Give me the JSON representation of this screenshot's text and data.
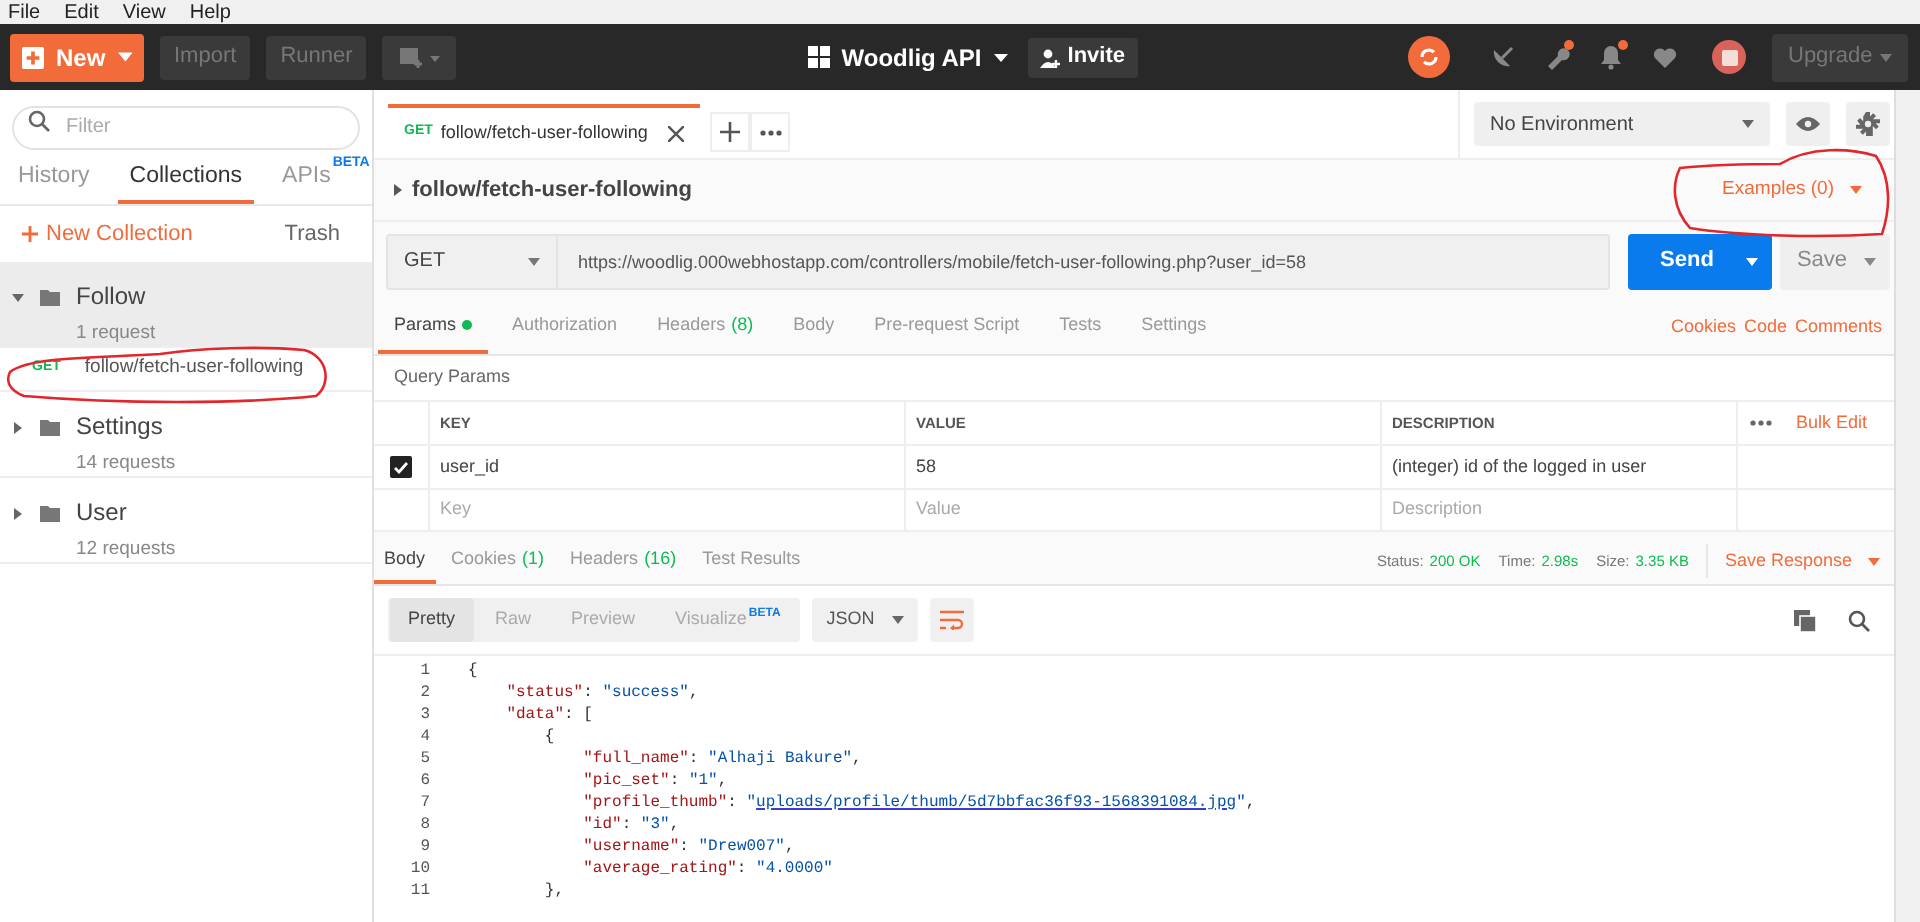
{
  "menu_bar": [
    "File",
    "Edit",
    "View",
    "Help"
  ],
  "header": {
    "new_button": "New",
    "buttons": [
      "Import",
      "Runner"
    ],
    "workspace": "Woodlig API",
    "invite": "Invite",
    "icons": [
      {
        "kind": "satellite",
        "dot": false
      },
      {
        "kind": "wrench",
        "dot": true
      },
      {
        "kind": "bell",
        "dot": true
      },
      {
        "kind": "heart",
        "dot": false
      }
    ],
    "upgrade": "Upgrade"
  },
  "sidebar": {
    "search": {
      "placeholder": "Filter"
    },
    "tabs": [
      {
        "label": "History",
        "selected": false
      },
      {
        "label": "Collections",
        "selected": true
      },
      {
        "label": "APIs",
        "badge": "BETA",
        "selected": false
      }
    ],
    "new_collection": "New Collection",
    "trash": "Trash",
    "collections": [
      {
        "name": "Follow",
        "count": "1 request",
        "expanded": true,
        "children": [
          {
            "method": "GET",
            "name": "follow/fetch-user-following",
            "selected": true
          }
        ]
      },
      {
        "name": "Settings",
        "count": "14 requests",
        "expanded": false
      },
      {
        "name": "User",
        "count": "12 requests",
        "expanded": false
      }
    ]
  },
  "request_tabs": [
    {
      "method": "GET",
      "label": "follow/fetch-user-following",
      "selected": true
    }
  ],
  "environment": "No Environment",
  "request": {
    "title": "follow/fetch-user-following",
    "examples": "Examples (0)",
    "method": "GET",
    "url": "https://woodlig.000webhostapp.com/controllers/mobile/fetch-user-following.php?user_id=58",
    "send": "Send",
    "save": "Save"
  },
  "request_sections": [
    {
      "label": "Params",
      "dot": true,
      "selected": true
    },
    {
      "label": "Authorization",
      "selected": false
    },
    {
      "label": "Headers",
      "count": "(8)",
      "selected": false
    },
    {
      "label": "Body",
      "selected": false
    },
    {
      "label": "Pre-request Script",
      "selected": false
    },
    {
      "label": "Tests",
      "selected": false
    },
    {
      "label": "Settings",
      "selected": false
    }
  ],
  "request_links": [
    "Cookies",
    "Code",
    "Comments"
  ],
  "query_params": {
    "title": "Query Params",
    "columns": [
      "KEY",
      "VALUE",
      "DESCRIPTION"
    ],
    "bulk_edit": "Bulk Edit",
    "rows": [
      {
        "checked": true,
        "key": "user_id",
        "value": "58",
        "description": "(integer) id of the logged in user"
      }
    ],
    "new_row": {
      "key": {
        "placeholder": "Key"
      },
      "value": {
        "placeholder": "Value"
      },
      "description": {
        "placeholder": "Description"
      }
    }
  },
  "response": {
    "tabs": [
      {
        "label": "Body",
        "selected": true
      },
      {
        "label": "Cookies",
        "count": "(1)",
        "selected": false
      },
      {
        "label": "Headers",
        "count": "(16)",
        "selected": false
      },
      {
        "label": "Test Results",
        "selected": false
      }
    ],
    "stats": [
      {
        "label": "Status:",
        "value": "200 OK"
      },
      {
        "label": "Time:",
        "value": "2.98s"
      },
      {
        "label": "Size:",
        "value": "3.35 KB"
      }
    ],
    "save_response": "Save Response",
    "views": [
      {
        "label": "Pretty",
        "selected": true
      },
      {
        "label": "Raw",
        "selected": false
      },
      {
        "label": "Preview",
        "selected": false
      },
      {
        "label": "Visualize",
        "badge": "BETA",
        "selected": false
      }
    ],
    "format": "JSON",
    "lines": [
      {
        "number": "1",
        "tokens": [
          {
            "kind": "punct",
            "text": "{"
          }
        ]
      },
      {
        "number": "2",
        "tokens": [
          {
            "kind": "key",
            "text": "    \"status\""
          },
          {
            "kind": "punct",
            "text": ": "
          },
          {
            "kind": "string",
            "text": "\"success\""
          },
          {
            "kind": "punct",
            "text": ","
          }
        ]
      },
      {
        "number": "3",
        "tokens": [
          {
            "kind": "key",
            "text": "    \"data\""
          },
          {
            "kind": "punct",
            "text": ": ["
          }
        ]
      },
      {
        "number": "4",
        "tokens": [
          {
            "kind": "punct",
            "text": "        {"
          }
        ]
      },
      {
        "number": "5",
        "tokens": [
          {
            "kind": "key",
            "text": "            \"full_name\""
          },
          {
            "kind": "punct",
            "text": ": "
          },
          {
            "kind": "string",
            "text": "\"Alhaji Bakure\""
          },
          {
            "kind": "punct",
            "text": ","
          }
        ]
      },
      {
        "number": "6",
        "tokens": [
          {
            "kind": "key",
            "text": "            \"pic_set\""
          },
          {
            "kind": "punct",
            "text": ": "
          },
          {
            "kind": "string",
            "text": "\"1\""
          },
          {
            "kind": "punct",
            "text": ","
          }
        ]
      },
      {
        "number": "7",
        "tokens": [
          {
            "kind": "key",
            "text": "            \"profile_thumb\""
          },
          {
            "kind": "punct",
            "text": ": "
          },
          {
            "kind": "string",
            "text": "\""
          },
          {
            "kind": "link",
            "text": "uploads/profile/thumb/5d7bbfac36f93-1568391084.jpg"
          },
          {
            "kind": "string",
            "text": "\""
          },
          {
            "kind": "punct",
            "text": ","
          }
        ]
      },
      {
        "number": "8",
        "tokens": [
          {
            "kind": "key",
            "text": "            \"id\""
          },
          {
            "kind": "punct",
            "text": ": "
          },
          {
            "kind": "string",
            "text": "\"3\""
          },
          {
            "kind": "punct",
            "text": ","
          }
        ]
      },
      {
        "number": "9",
        "tokens": [
          {
            "kind": "key",
            "text": "            \"username\""
          },
          {
            "kind": "punct",
            "text": ": "
          },
          {
            "kind": "string",
            "text": "\"Drew007\""
          },
          {
            "kind": "punct",
            "text": ","
          }
        ]
      },
      {
        "number": "10",
        "tokens": [
          {
            "kind": "key",
            "text": "            \"average_rating\""
          },
          {
            "kind": "punct",
            "text": ": "
          },
          {
            "kind": "string",
            "text": "\"4.0000\""
          }
        ]
      },
      {
        "number": "11",
        "tokens": [
          {
            "kind": "punct",
            "text": "        },"
          }
        ]
      }
    ]
  }
}
